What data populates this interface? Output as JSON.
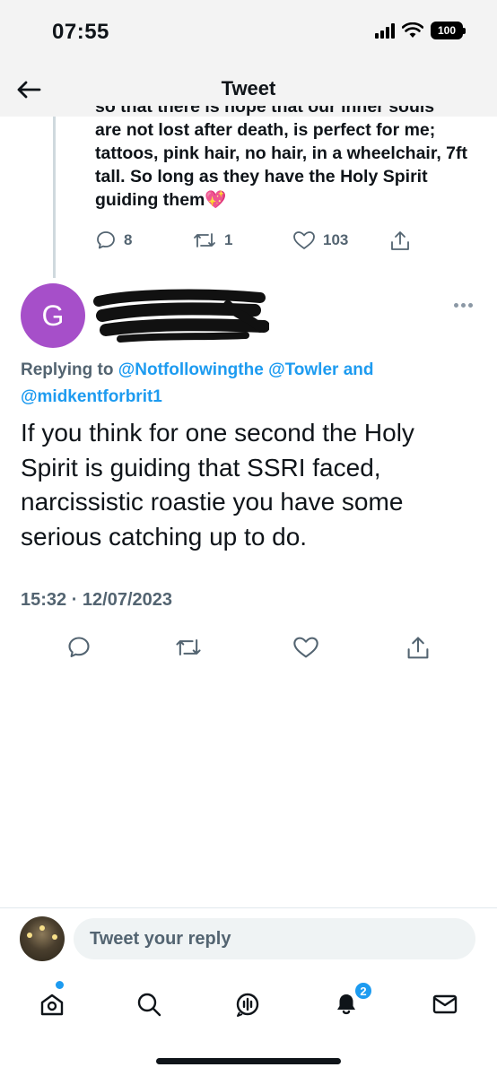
{
  "status_bar": {
    "time": "07:55",
    "battery": "100"
  },
  "header": {
    "title": "Tweet"
  },
  "previous_tweet": {
    "text_cut": "so that there is hope that our inner souls",
    "text": "are not lost after death, is perfect for me; tattoos, pink hair, no hair, in a wheelchair, 7ft tall. So long as they have the Holy Spirit guiding them💖",
    "replies": "8",
    "retweets": "1",
    "likes": "103"
  },
  "tweet": {
    "avatar_letter": "G",
    "replying_to_prefix": "Replying to ",
    "mention_1": "@Notfollowingthe",
    "mention_2": "@Towler",
    "and": " and ",
    "mention_3": "@midkentforbrit1",
    "body": "If you think for one second the Holy Spirit is guiding that SSRI faced, narcissistic roastie you have some serious catching up to do.",
    "timestamp": "15:32 · 12/07/2023"
  },
  "reply_bar": {
    "placeholder": "Tweet your reply"
  },
  "tabbar": {
    "notifications_badge": "2"
  },
  "colors": {
    "accent": "#1d9bf0",
    "avatar_bg": "#a64fc9",
    "muted": "#536471"
  },
  "icons": {
    "back": "arrow-left-icon",
    "reply": "comment-icon",
    "retweet": "retweet-icon",
    "like": "heart-icon",
    "share": "share-icon",
    "more": "ellipsis-icon",
    "home": "home-icon",
    "search": "search-icon",
    "spaces": "spaces-icon",
    "notifications": "bell-icon",
    "messages": "envelope-icon"
  }
}
